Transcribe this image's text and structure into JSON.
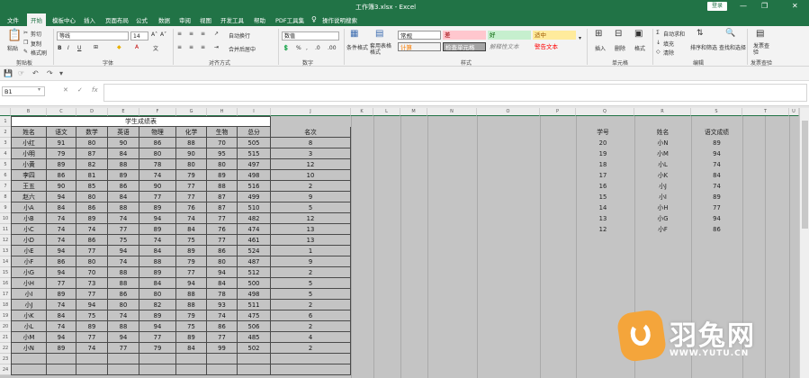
{
  "window": {
    "title": "工作簿3.xlsx  -  Excel",
    "login": "登录",
    "min": "—",
    "restore": "❐",
    "close": "✕"
  },
  "menu": [
    "文件",
    "开始",
    "模板中心",
    "插入",
    "页面布局",
    "公式",
    "数据",
    "审阅",
    "视图",
    "开发工具",
    "帮助",
    "PDF工具集",
    "操作说明搜索"
  ],
  "ribbon": {
    "paste": "粘贴",
    "cut": "剪切",
    "copy": "复制",
    "painter": "格式刷",
    "clipboard": "剪贴板",
    "font_name": "等线",
    "font_size": "14",
    "bold": "B",
    "italic": "I",
    "underline": "U",
    "font": "字体",
    "wrap": "自动换行",
    "merge": "合并后居中",
    "align": "对齐方式",
    "numfmt": "数值",
    "number": "数字",
    "cond": "条件格式",
    "table_fmt": "套用表格格式",
    "styles_label": "样式",
    "style_normal": "常规",
    "style_bad": "差",
    "style_good": "好",
    "style_neutral": "适中",
    "style_calc": "计算",
    "style_check": "检查单元格",
    "style_explain": "解释性文本",
    "style_warn": "警告文本",
    "insert": "插入",
    "delete": "删除",
    "format": "格式",
    "cells": "单元格",
    "autosum": "自动求和",
    "fill": "填充",
    "clear": "清除",
    "sort": "排序和筛选",
    "find": "查找和选择",
    "editing": "编辑",
    "publish": "发票查验",
    "publish_group": "发票查验"
  },
  "formula_bar": {
    "name_box": "B1",
    "fx": "fx",
    "cancel": "✕",
    "enter": "✓",
    "value": ""
  },
  "columns": [
    "B",
    "C",
    "D",
    "E",
    "F",
    "G",
    "H",
    "I",
    "J",
    "K",
    "L",
    "M",
    "N",
    "O",
    "P",
    "Q",
    "R",
    "S",
    "T",
    "U"
  ],
  "rows": [
    "1",
    "2",
    "3",
    "4",
    "5",
    "6",
    "7",
    "8",
    "9",
    "10",
    "11",
    "12",
    "13",
    "14",
    "15",
    "16",
    "17",
    "18",
    "19",
    "20",
    "21",
    "22",
    "23",
    "24"
  ],
  "table": {
    "title": "学生成绩表",
    "headers": [
      "姓名",
      "语文",
      "数学",
      "英语",
      "物理",
      "化学",
      "生物",
      "总分",
      "名次"
    ],
    "rows": [
      [
        "小红",
        "91",
        "80",
        "90",
        "86",
        "88",
        "70",
        "505",
        "8"
      ],
      [
        "小明",
        "79",
        "87",
        "84",
        "80",
        "90",
        "95",
        "515",
        "3"
      ],
      [
        "小黄",
        "89",
        "82",
        "88",
        "78",
        "80",
        "80",
        "497",
        "12"
      ],
      [
        "李四",
        "86",
        "81",
        "89",
        "74",
        "79",
        "89",
        "498",
        "10"
      ],
      [
        "王五",
        "90",
        "85",
        "86",
        "90",
        "77",
        "88",
        "516",
        "2"
      ],
      [
        "赵六",
        "94",
        "80",
        "84",
        "77",
        "77",
        "87",
        "499",
        "9"
      ],
      [
        "小A",
        "84",
        "86",
        "88",
        "89",
        "76",
        "87",
        "510",
        "5"
      ],
      [
        "小B",
        "74",
        "89",
        "74",
        "94",
        "74",
        "77",
        "482",
        "12"
      ],
      [
        "小C",
        "74",
        "74",
        "77",
        "89",
        "84",
        "76",
        "474",
        "13"
      ],
      [
        "小D",
        "74",
        "86",
        "75",
        "74",
        "75",
        "77",
        "461",
        "13"
      ],
      [
        "小E",
        "94",
        "77",
        "94",
        "84",
        "89",
        "86",
        "524",
        "1"
      ],
      [
        "小F",
        "86",
        "80",
        "74",
        "88",
        "79",
        "80",
        "487",
        "9"
      ],
      [
        "小G",
        "94",
        "70",
        "88",
        "89",
        "77",
        "94",
        "512",
        "2"
      ],
      [
        "小H",
        "77",
        "73",
        "88",
        "84",
        "94",
        "84",
        "500",
        "5"
      ],
      [
        "小I",
        "89",
        "77",
        "86",
        "80",
        "88",
        "78",
        "498",
        "5"
      ],
      [
        "小J",
        "74",
        "94",
        "80",
        "82",
        "88",
        "93",
        "511",
        "2"
      ],
      [
        "小K",
        "84",
        "75",
        "74",
        "89",
        "79",
        "74",
        "475",
        "6"
      ],
      [
        "小L",
        "74",
        "89",
        "88",
        "94",
        "75",
        "86",
        "506",
        "2"
      ],
      [
        "小M",
        "94",
        "77",
        "94",
        "77",
        "89",
        "77",
        "485",
        "4"
      ],
      [
        "小N",
        "89",
        "74",
        "77",
        "79",
        "84",
        "99",
        "502",
        "2"
      ]
    ]
  },
  "side_table": {
    "headers": [
      "学号",
      "姓名",
      "语文成绩"
    ],
    "rows": [
      [
        "20",
        "小N",
        "89"
      ],
      [
        "19",
        "小M",
        "94"
      ],
      [
        "18",
        "小L",
        "74"
      ],
      [
        "17",
        "小K",
        "84"
      ],
      [
        "16",
        "小J",
        "74"
      ],
      [
        "15",
        "小I",
        "89"
      ],
      [
        "14",
        "小H",
        "77"
      ],
      [
        "13",
        "小G",
        "94"
      ],
      [
        "12",
        "小F",
        "86"
      ]
    ]
  },
  "watermark": {
    "brand": "羽兔网",
    "url": "WWW.YUTU.CN"
  }
}
